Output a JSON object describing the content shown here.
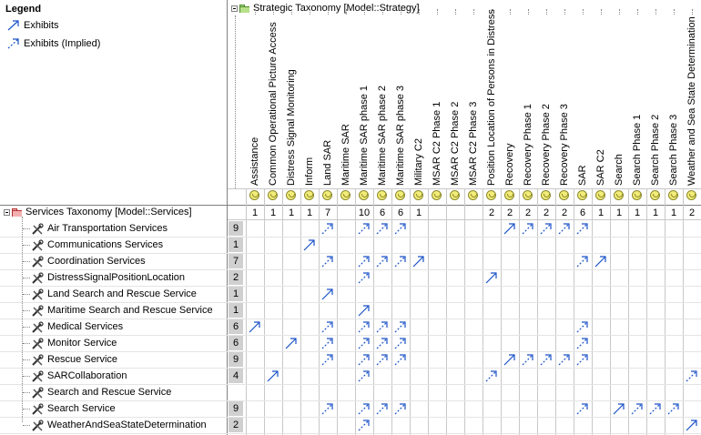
{
  "legend": {
    "title": "Legend",
    "items": [
      {
        "label": "Exhibits",
        "style": "solid"
      },
      {
        "label": "Exhibits (Implied)",
        "style": "dashed"
      }
    ]
  },
  "columns_header": {
    "label": "Strategic Taxonomy [Model::Strategy]",
    "icon": "green-package-icon"
  },
  "rows_header": {
    "label": "Services Taxonomy [Model::Services]",
    "icon": "red-package-icon"
  },
  "columns": [
    {
      "label": "Assistance",
      "count": "1"
    },
    {
      "label": "Common Operational Picture Access",
      "count": "1"
    },
    {
      "label": "Distress Signal Monitoring",
      "count": "1"
    },
    {
      "label": "Inform",
      "count": "1"
    },
    {
      "label": "Land SAR",
      "count": "7"
    },
    {
      "label": "Maritime SAR",
      "count": ""
    },
    {
      "label": "Maritime SAR phase 1",
      "count": "10"
    },
    {
      "label": "Maritime SAR phase 2",
      "count": "6"
    },
    {
      "label": "Maritime SAR phase 3",
      "count": "6"
    },
    {
      "label": "Military C2",
      "count": "1"
    },
    {
      "label": "MSAR C2 Phase 1",
      "count": ""
    },
    {
      "label": "MSAR C2 Phase 2",
      "count": ""
    },
    {
      "label": "MSAR C2 Phase 3",
      "count": ""
    },
    {
      "label": "Position Location of Persons in Distress",
      "count": "2"
    },
    {
      "label": "Recovery",
      "count": "2"
    },
    {
      "label": "Recovery Phase 1",
      "count": "2"
    },
    {
      "label": "Recovery Phase 2",
      "count": "2"
    },
    {
      "label": "Recovery Phase 3",
      "count": "2"
    },
    {
      "label": "SAR",
      "count": "6"
    },
    {
      "label": "SAR C2",
      "count": "1"
    },
    {
      "label": "Search",
      "count": "1"
    },
    {
      "label": "Search Phase 1",
      "count": "1"
    },
    {
      "label": "Search Phase 2",
      "count": "1"
    },
    {
      "label": "Search Phase 3",
      "count": "1"
    },
    {
      "label": "Weather and Sea State Determination",
      "count": "2"
    }
  ],
  "rows": [
    {
      "label": "Air Transportation Services",
      "count": "9",
      "cells": {
        "4": "i",
        "6": "i",
        "7": "i",
        "8": "i",
        "14": "s",
        "15": "i",
        "16": "i",
        "17": "i",
        "18": "i"
      }
    },
    {
      "label": "Communications Services",
      "count": "1",
      "cells": {
        "3": "s"
      }
    },
    {
      "label": "Coordination Services",
      "count": "7",
      "cells": {
        "4": "i",
        "6": "i",
        "7": "i",
        "8": "i",
        "9": "s",
        "18": "i",
        "19": "s"
      }
    },
    {
      "label": "DistressSignalPositionLocation",
      "count": "2",
      "cells": {
        "6": "i",
        "13": "s"
      }
    },
    {
      "label": "Land Search and Rescue Service",
      "count": "1",
      "cells": {
        "4": "s"
      }
    },
    {
      "label": "Maritime Search and Rescue Service",
      "count": "1",
      "cells": {
        "6": "s"
      }
    },
    {
      "label": "Medical Services",
      "count": "6",
      "cells": {
        "0": "s",
        "4": "i",
        "6": "i",
        "7": "i",
        "8": "i",
        "18": "i"
      }
    },
    {
      "label": "Monitor Service",
      "count": "6",
      "cells": {
        "2": "s",
        "4": "i",
        "6": "i",
        "7": "i",
        "8": "i",
        "18": "i"
      }
    },
    {
      "label": "Rescue Service",
      "count": "9",
      "cells": {
        "4": "i",
        "6": "i",
        "7": "i",
        "8": "i",
        "14": "s",
        "15": "i",
        "16": "i",
        "17": "i",
        "18": "i"
      }
    },
    {
      "label": "SARCollaboration",
      "count": "4",
      "cells": {
        "1": "s",
        "6": "i",
        "13": "i",
        "24": "i"
      }
    },
    {
      "label": "Search and Rescue Service",
      "count": "",
      "cells": {}
    },
    {
      "label": "Search Service",
      "count": "9",
      "cells": {
        "4": "i",
        "6": "i",
        "7": "i",
        "8": "i",
        "18": "i",
        "20": "s",
        "21": "i",
        "22": "i",
        "23": "i"
      }
    },
    {
      "label": "WeatherAndSeaStateDetermination",
      "count": "2",
      "cells": {
        "6": "i",
        "24": "s"
      }
    }
  ],
  "colors": {
    "arrow": "#1a52c8",
    "grid": "#c8c8c8",
    "count_bg": "#d0d0d0"
  }
}
